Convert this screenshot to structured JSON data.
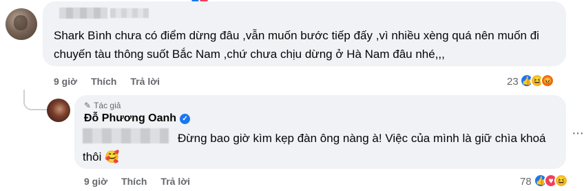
{
  "comment1": {
    "text": "Shark Bình chưa có điểm dừng đâu ,vẫn muốn bước tiếp đấy ,vì nhiều xèng quá nên muốn đi chuyến tàu thông suốt Bắc Nam ,chứ chưa chịu dừng ở Hà Nam đâu nhé,,,",
    "time": "9 giờ",
    "like_label": "Thích",
    "reply_label": "Trả lời",
    "reaction_count": "23",
    "reactions": [
      "like-icon",
      "haha-icon",
      "angry-icon"
    ]
  },
  "comment2": {
    "author_badge": "Tác giả",
    "author_name": "Đỗ Phương Oanh",
    "text": "Đừng bao giờ kìm kẹp đàn ông nàng à! Việc của mình là giữ chìa khoá thôi 🥰",
    "time": "9 giờ",
    "like_label": "Thích",
    "reply_label": "Trả lời",
    "reaction_count": "78",
    "reactions": [
      "like-icon",
      "love-icon",
      "haha-icon"
    ]
  },
  "more_options": "···",
  "colors": {
    "bubble": "#f0f2f5",
    "meta_text": "#65676b",
    "like": "#1877f2",
    "love": "#f33e58",
    "haha": "#f7b928",
    "angry": "#e9710f"
  }
}
